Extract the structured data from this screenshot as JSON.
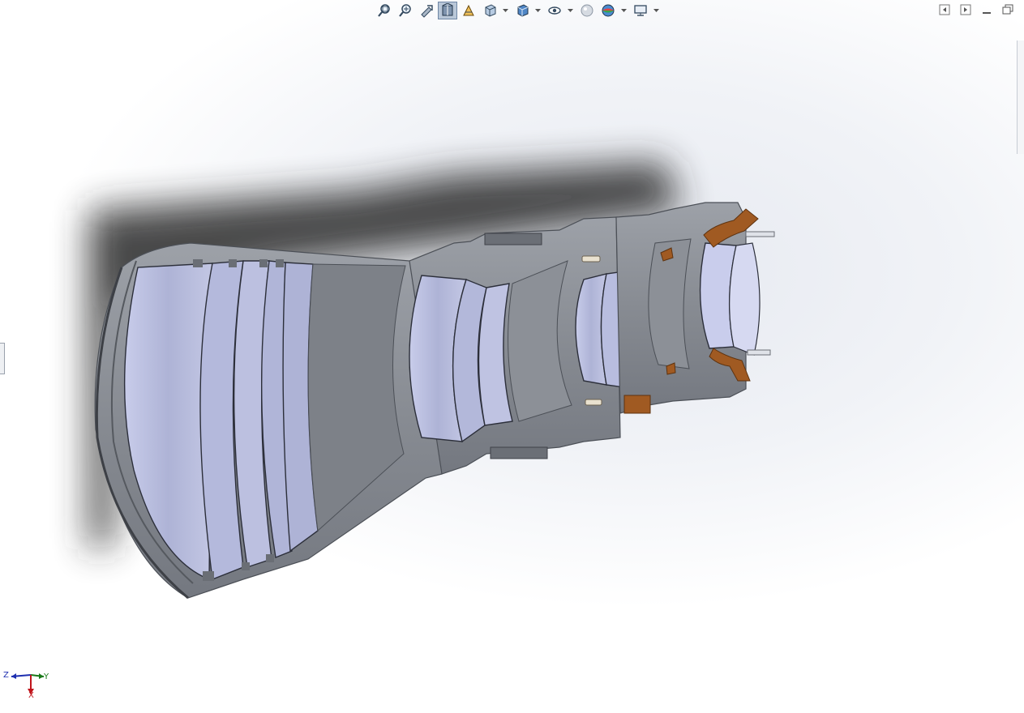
{
  "window": {
    "controls": [
      {
        "name": "prev-view-icon"
      },
      {
        "name": "next-view-icon"
      },
      {
        "name": "minimize-icon"
      },
      {
        "name": "restore-icon"
      }
    ]
  },
  "heads_up_toolbar": {
    "items": [
      {
        "name": "zoom-to-fit-icon",
        "active": false,
        "caret": false
      },
      {
        "name": "zoom-to-area-icon",
        "active": false,
        "caret": false
      },
      {
        "name": "previous-view-icon",
        "active": false,
        "caret": false
      },
      {
        "name": "section-view-icon",
        "active": true,
        "caret": false
      },
      {
        "name": "dynamic-annotation-icon",
        "active": false,
        "caret": false
      },
      {
        "name": "view-orientation-icon",
        "active": false,
        "caret": true
      },
      {
        "name": "display-style-icon",
        "active": false,
        "caret": true
      },
      {
        "name": "hide-show-items-icon",
        "active": false,
        "caret": true
      },
      {
        "name": "edit-appearance-icon",
        "active": false,
        "caret": false
      },
      {
        "name": "apply-scene-icon",
        "active": false,
        "caret": true
      },
      {
        "name": "view-settings-icon",
        "active": false,
        "caret": true
      }
    ]
  },
  "triad": {
    "x_label": "X",
    "y_label": "Y",
    "z_label": "Z",
    "colors": {
      "x": "#c0141b",
      "y": "#1a7a1a",
      "z": "#1e2fb0"
    }
  },
  "model": {
    "colors": {
      "housing": "#8a8e95",
      "housing_light": "#a8acb2",
      "housing_dark": "#5c6168",
      "lens": "#b9bedd",
      "lens_edge": "#2c2f3a",
      "bronze": "#a05a22",
      "shadow": "#2a2a2c"
    }
  }
}
